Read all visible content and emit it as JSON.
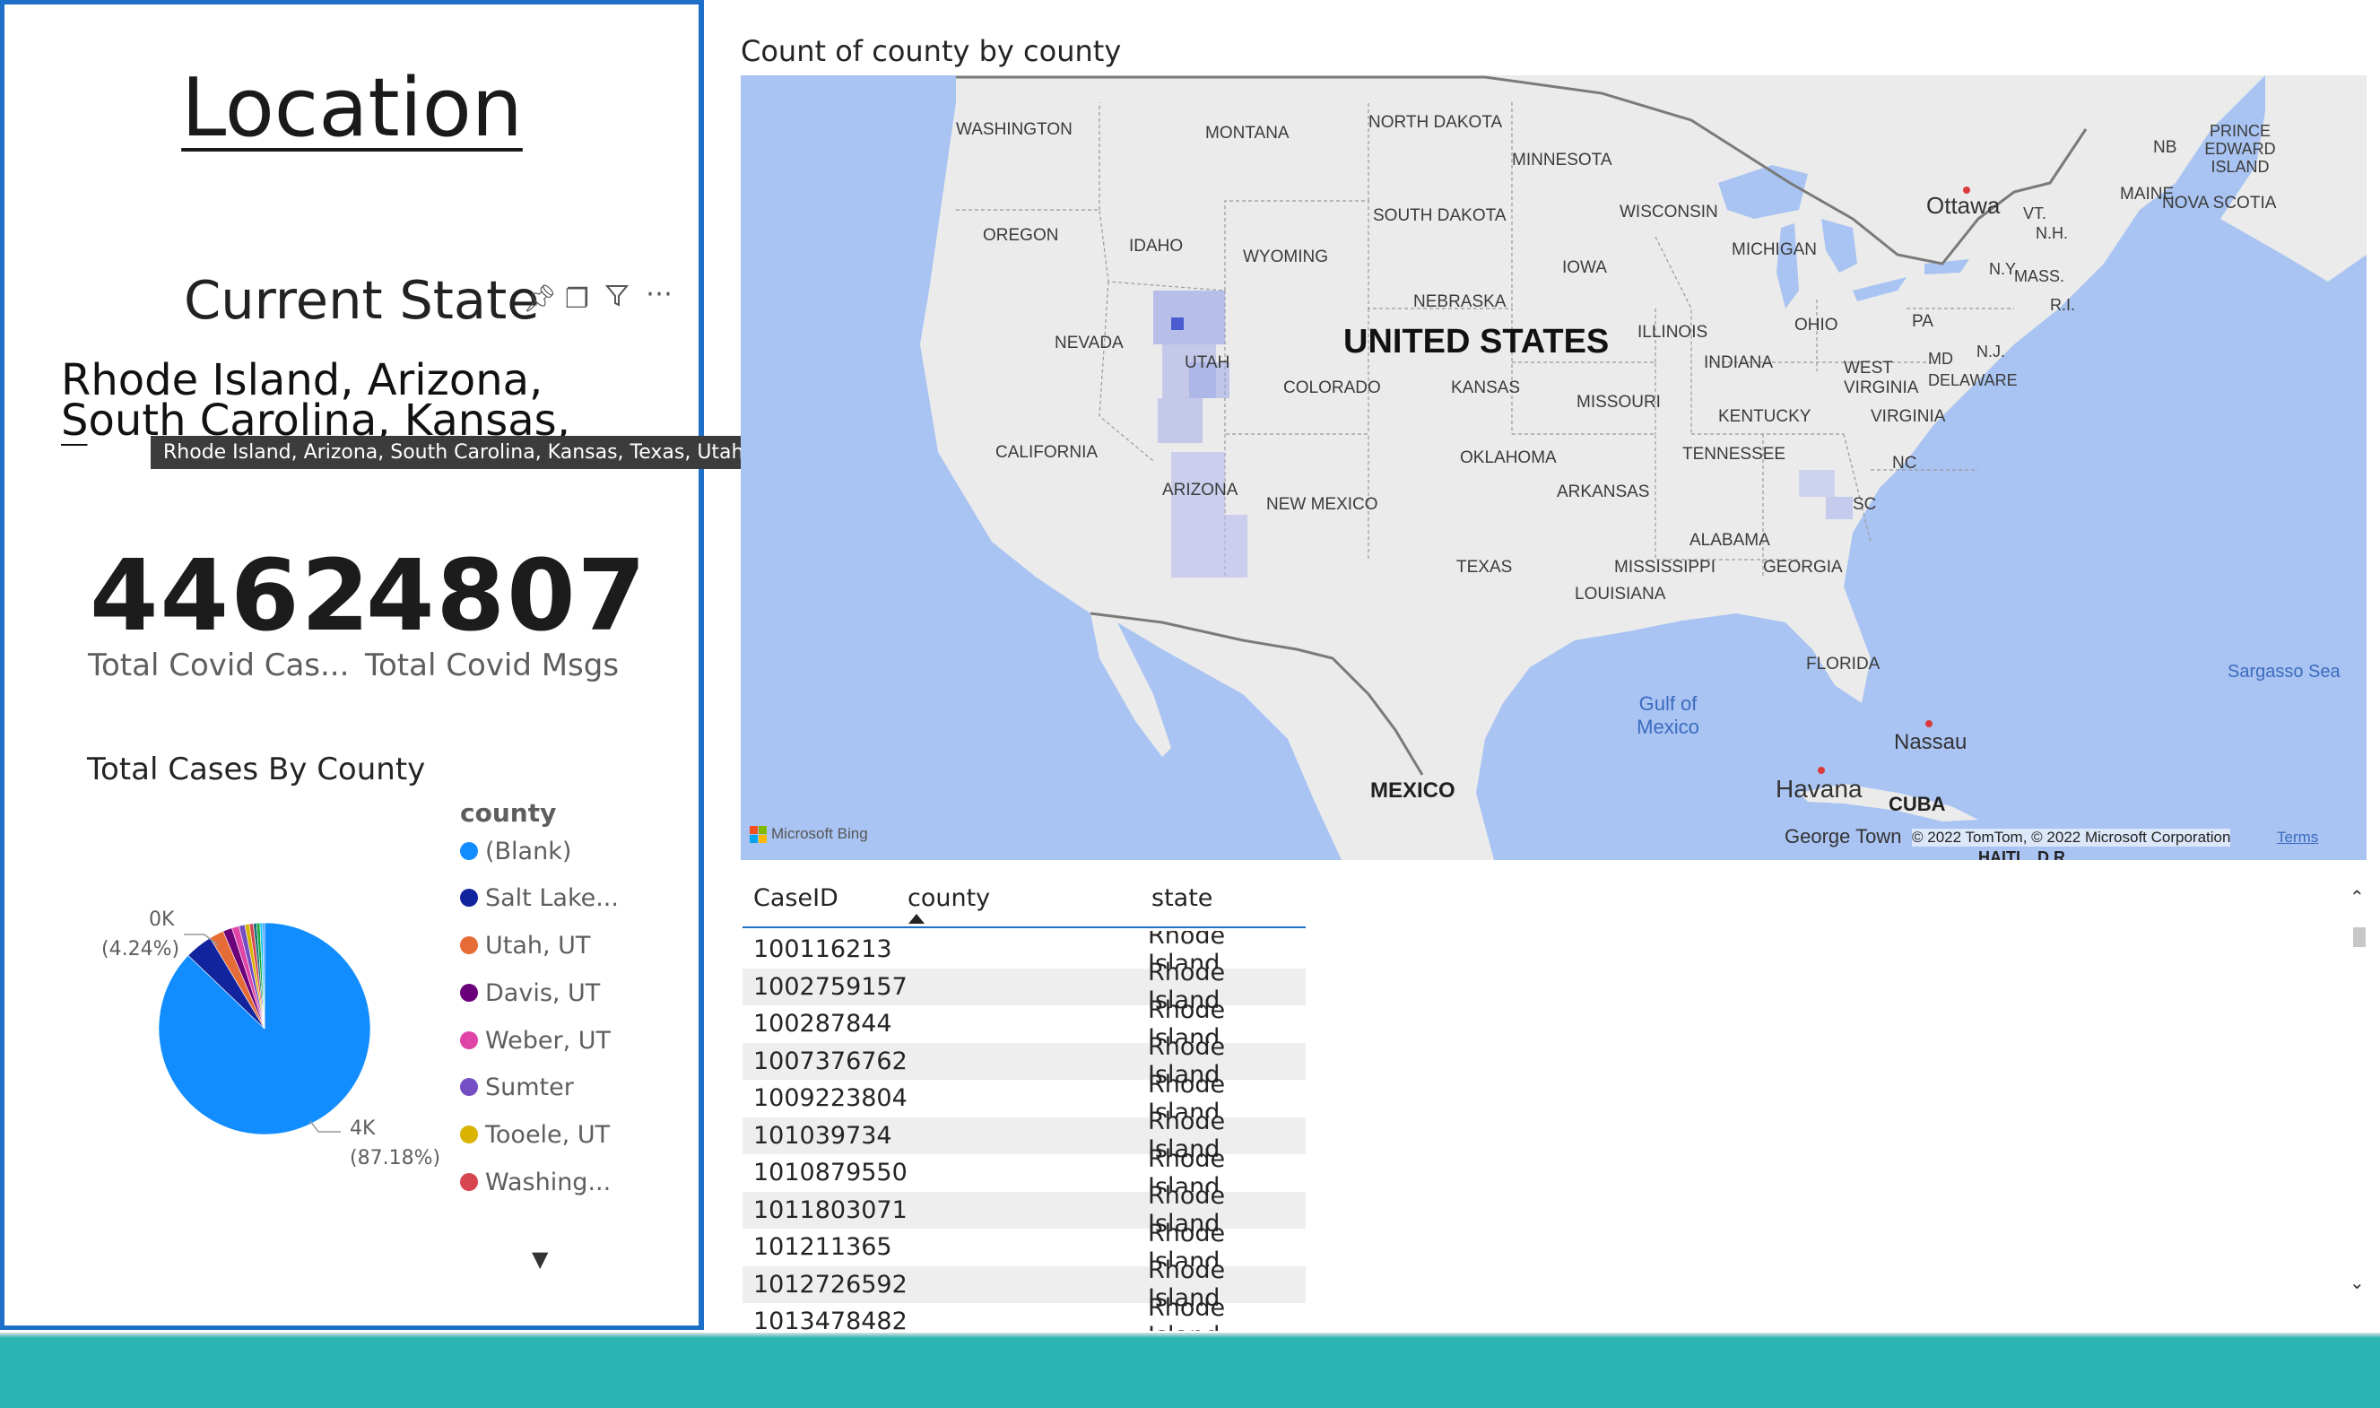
{
  "left": {
    "title": "Location",
    "current_state_title": "Current State",
    "current_state_value": "Rhode Island, Arizona, South Carolina, Kansas, Texas, Utah",
    "tooltip": "Rhode Island, Arizona, South Carolina, Kansas, Texas, Utah",
    "visual_icons": [
      "pin-icon",
      "copy-icon",
      "filter-icon",
      "more-options-icon"
    ],
    "kpis": [
      {
        "value": "4462",
        "label": "Total Covid Cas..."
      },
      {
        "value": "4807",
        "label": "Total Covid Msgs"
      }
    ]
  },
  "pie": {
    "title": "Total Cases By County",
    "legend_title": "county",
    "legend": [
      {
        "label": "(Blank)",
        "color": "#118dff"
      },
      {
        "label": "Salt Lake...",
        "color": "#12239e"
      },
      {
        "label": "Utah, UT",
        "color": "#e66c37"
      },
      {
        "label": "Davis, UT",
        "color": "#6b007b"
      },
      {
        "label": "Weber, UT",
        "color": "#e044a7"
      },
      {
        "label": "Sumter",
        "color": "#744ec2"
      },
      {
        "label": "Tooele, UT",
        "color": "#d9b300"
      },
      {
        "label": "Washing...",
        "color": "#d64550"
      }
    ],
    "label_small_value": "0K",
    "label_small_pct": "(4.24%)",
    "label_big_value": "4K",
    "label_big_pct": "(87.18%)",
    "slices_pct": [
      87.18,
      4.24,
      2.2,
      1.4,
      1.1,
      0.9,
      0.7,
      0.6,
      0.5,
      0.5,
      0.4,
      0.3
    ]
  },
  "map": {
    "title": "Count of county by county",
    "states": [
      "WASHINGTON",
      "MONTANA",
      "NORTH DAKOTA",
      "MINNESOTA",
      "OREGON",
      "IDAHO",
      "WYOMING",
      "SOUTH DAKOTA",
      "WISCONSIN",
      "MICHIGAN",
      "NEBRASKA",
      "IOWA",
      "NEVADA",
      "UTAH",
      "COLORADO",
      "KANSAS",
      "ILLINOIS",
      "INDIANA",
      "OHIO",
      "PA",
      "CALIFORNIA",
      "ARIZONA",
      "NEW MEXICO",
      "OKLAHOMA",
      "MISSOURI",
      "KENTUCKY",
      "WEST VIRGINIA",
      "VIRGINIA",
      "TENNESSEE",
      "ARKANSAS",
      "NC",
      "SC",
      "ALABAMA",
      "MISSISSIPPI",
      "GEORGIA",
      "LOUISIANA",
      "TEXAS",
      "FLORIDA",
      "MAINE",
      "VT.",
      "N.H.",
      "N.Y.",
      "MASS.",
      "R.I.",
      "N.J.",
      "MD",
      "DELAWARE",
      "NB",
      "PRINCE EDWARD ISLAND",
      "NOVA SCOTIA"
    ],
    "country": "UNITED STATES",
    "cities": [
      "Ottawa",
      "Nassau",
      "Havana",
      "George Town"
    ],
    "countries_other": [
      "MEXICO",
      "CUBA",
      "HAITI",
      "D.R."
    ],
    "water": [
      "Gulf of Mexico",
      "Sargasso Sea"
    ],
    "attribution": "© 2022 TomTom, © 2022 Microsoft Corporation",
    "terms": "Terms",
    "logo_text": "Microsoft Bing"
  },
  "table": {
    "columns": [
      "CaseID",
      "county",
      "state"
    ],
    "rows": [
      [
        "100116213",
        "",
        "Rhode Island"
      ],
      [
        "1002759157",
        "",
        "Rhode Island"
      ],
      [
        "100287844",
        "",
        "Rhode Island"
      ],
      [
        "1007376762",
        "",
        "Rhode Island"
      ],
      [
        "1009223804",
        "",
        "Rhode Island"
      ],
      [
        "101039734",
        "",
        "Rhode Island"
      ],
      [
        "1010879550",
        "",
        "Rhode Island"
      ],
      [
        "1011803071",
        "",
        "Rhode Island"
      ],
      [
        "101211365",
        "",
        "Rhode Island"
      ],
      [
        "1012726592",
        "",
        "Rhode Island"
      ],
      [
        "1013478482",
        "",
        "Rhode Island"
      ]
    ]
  }
}
